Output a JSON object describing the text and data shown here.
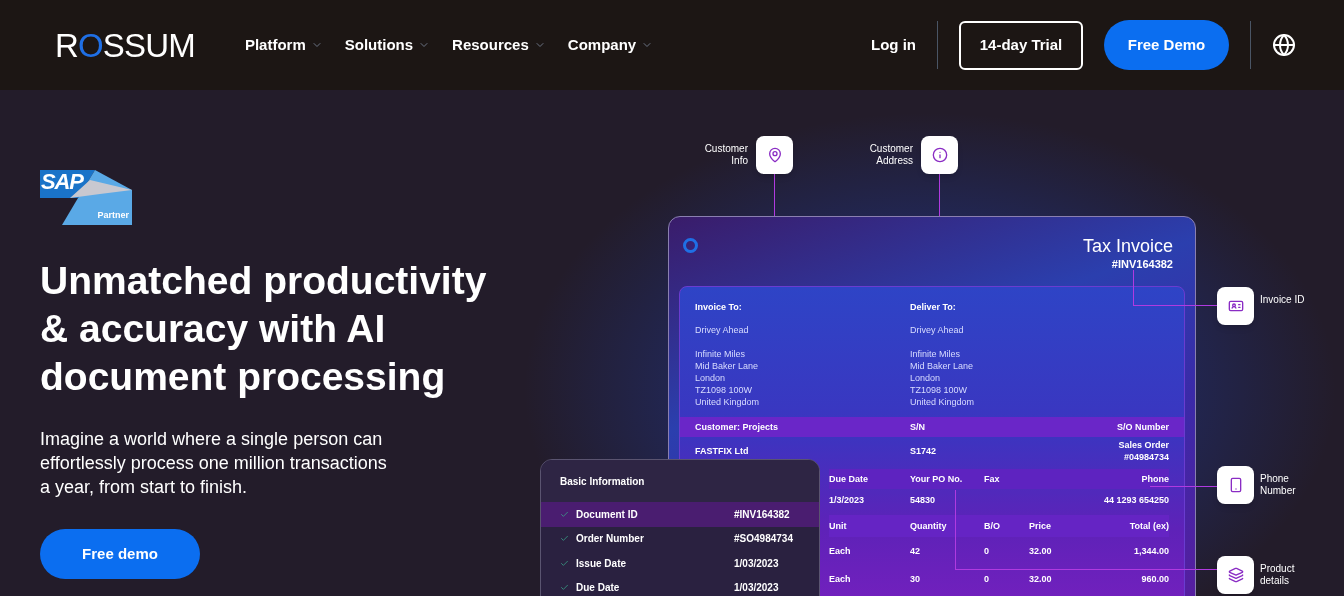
{
  "header": {
    "logo": "ROSSUM",
    "nav": [
      {
        "label": "Platform"
      },
      {
        "label": "Solutions"
      },
      {
        "label": "Resources"
      },
      {
        "label": "Company"
      }
    ],
    "login": "Log in",
    "trial_button": "14-day Trial",
    "demo_button": "Free Demo"
  },
  "hero": {
    "badge": {
      "brand": "SAP",
      "tier": "Partner"
    },
    "heading": "Unmatched productivity & accuracy with AI document processing",
    "text": "Imagine a world where a single person can effortlessly process one million transactions a year, from start to finish.",
    "button": "Free demo"
  },
  "illustration": {
    "callouts": [
      {
        "label": "Customer Info",
        "kind": "pin"
      },
      {
        "label": "Customer Address",
        "kind": "info"
      },
      {
        "label": "Invoice ID",
        "kind": "id-card"
      },
      {
        "label": "Phone Number",
        "kind": "phone"
      },
      {
        "label": "Product details",
        "kind": "layers"
      }
    ],
    "invoice": {
      "title": "Tax Invoice",
      "number": "#INV164382",
      "parties": [
        {
          "heading": "Invoice To:",
          "name": "Drivey Ahead",
          "address": [
            "Infinite Miles",
            "Mid Baker Lane",
            "London",
            "TZ1098 100W",
            "United Kingdom"
          ]
        },
        {
          "heading": "Deliver To:",
          "name": "Drivey Ahead",
          "address": [
            "Infinite Miles",
            "Mid Baker Lane",
            "London",
            "TZ1098 100W",
            "United Kingdom"
          ]
        }
      ],
      "customer_header": [
        "Customer: Projects",
        "S/N",
        "S/O Number"
      ],
      "customer_row": [
        "FASTFIX Ltd",
        "S1742",
        "Sales Order #04984734"
      ],
      "order_header": [
        "Due Date",
        "Your PO No.",
        "Fax",
        "Phone"
      ],
      "order_row": {
        "due_date": "1/3/2023",
        "po_number": "54830",
        "phone": "44 1293 654250"
      },
      "items_header": [
        "Unit",
        "Quantity",
        "B/O",
        "Price",
        "Total (ex)"
      ],
      "items": [
        [
          "Each",
          "42",
          "0",
          "32.00",
          "1,344.00"
        ],
        [
          "Each",
          "30",
          "0",
          "32.00",
          "960.00"
        ]
      ]
    },
    "basic_info": {
      "title": "Basic Information",
      "fields": [
        {
          "label": "Document ID",
          "value": "#INV164382",
          "checked": true,
          "selected": true
        },
        {
          "label": "Order Number",
          "value": "#SO4984734",
          "checked": true,
          "selected": false
        },
        {
          "label": "Issue Date",
          "value": "1/03/2023",
          "checked": true,
          "selected": false
        },
        {
          "label": "Due Date",
          "value": "1/03/2023",
          "checked": true,
          "selected": false
        }
      ]
    }
  }
}
